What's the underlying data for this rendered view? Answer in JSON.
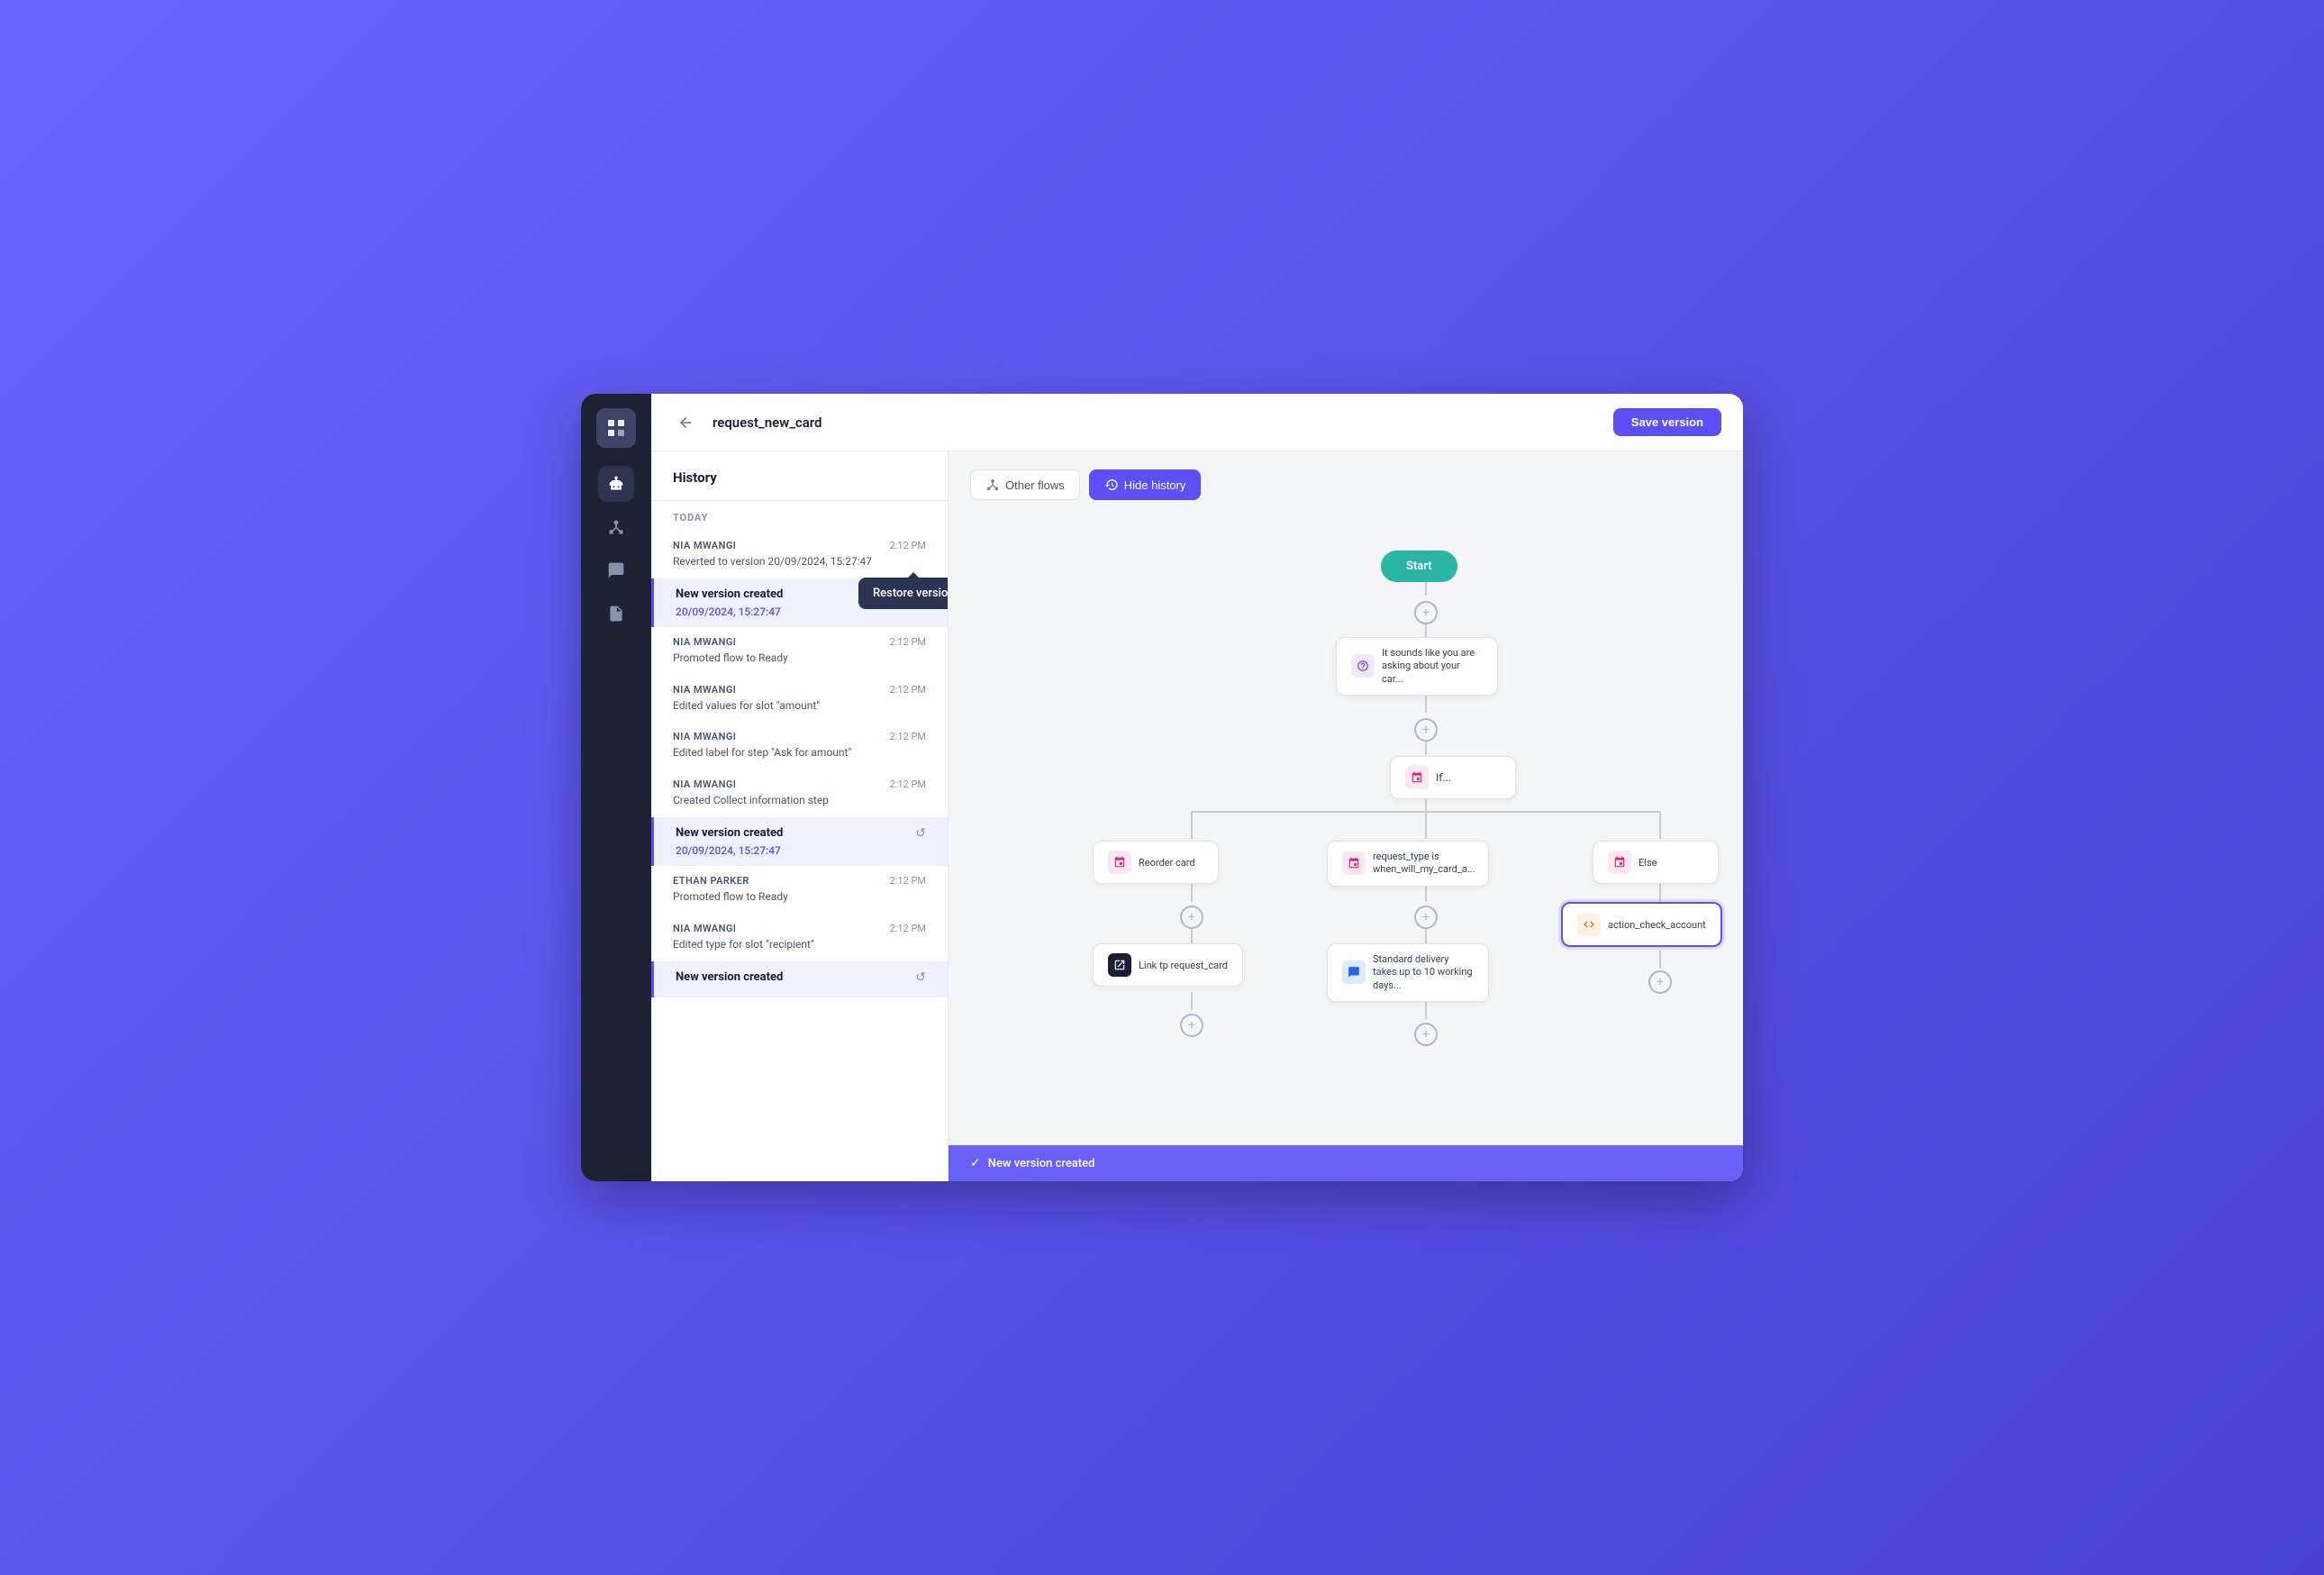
{
  "app": {
    "title": "request_new_card",
    "save_button_label": "Save version"
  },
  "sidebar": {
    "icons": [
      {
        "name": "logo-icon",
        "symbol": "▦"
      },
      {
        "name": "bot-icon",
        "symbol": "🤖"
      },
      {
        "name": "flow-icon",
        "symbol": "⬡"
      },
      {
        "name": "chat-icon",
        "symbol": "💬"
      },
      {
        "name": "document-icon",
        "symbol": "📄"
      }
    ]
  },
  "history_panel": {
    "title": "History",
    "day_label": "TODAY",
    "items": [
      {
        "type": "action",
        "author": "NIA MWANGI",
        "time": "2:12 PM",
        "action": "Reverted to version 20/09/2024, 15:27:47",
        "show_tooltip": true
      },
      {
        "type": "version",
        "label": "New version created",
        "date": "20/09/2024, 15:27:47",
        "selected": true
      },
      {
        "type": "action",
        "author": "NIA MWANGI",
        "time": "2:12 PM",
        "action": "Promoted flow to Ready"
      },
      {
        "type": "action",
        "author": "NIA MWANGI",
        "time": "2:12 PM",
        "action": "Edited values for slot \"amount\""
      },
      {
        "type": "action",
        "author": "NIA MWANGI",
        "time": "2:12 PM",
        "action": "Edited label for step \"Ask for amount\""
      },
      {
        "type": "action",
        "author": "NIA MWANGI",
        "time": "2:12 PM",
        "action": "Created Collect information step"
      },
      {
        "type": "version",
        "label": "New version created",
        "date": "20/09/2024, 15:27:47",
        "selected": false
      },
      {
        "type": "action",
        "author": "ETHAN PARKER",
        "time": "2:12 PM",
        "action": "Promoted flow to Ready"
      },
      {
        "type": "action",
        "author": "NIA MWANGI",
        "time": "2:12 PM",
        "action": "Edited type for slot \"recipient\""
      },
      {
        "type": "version",
        "label": "New version created",
        "date": "",
        "selected": false
      }
    ]
  },
  "tooltip": {
    "label": "Restore version"
  },
  "canvas": {
    "other_flows_label": "Other flows",
    "hide_history_label": "Hide history",
    "nodes": {
      "start": "Start",
      "question": "It sounds like you are asking about your car...",
      "if_node": "If...",
      "branch1": "Reorder card",
      "branch2": "request_type is when_will_my_card_a...",
      "branch3": "Else",
      "link": "Link tp request_card",
      "delivery": "Standard delivery takes up to 10 working days...",
      "action": "action_check_account"
    }
  },
  "status_bar": {
    "message": "New version created"
  }
}
